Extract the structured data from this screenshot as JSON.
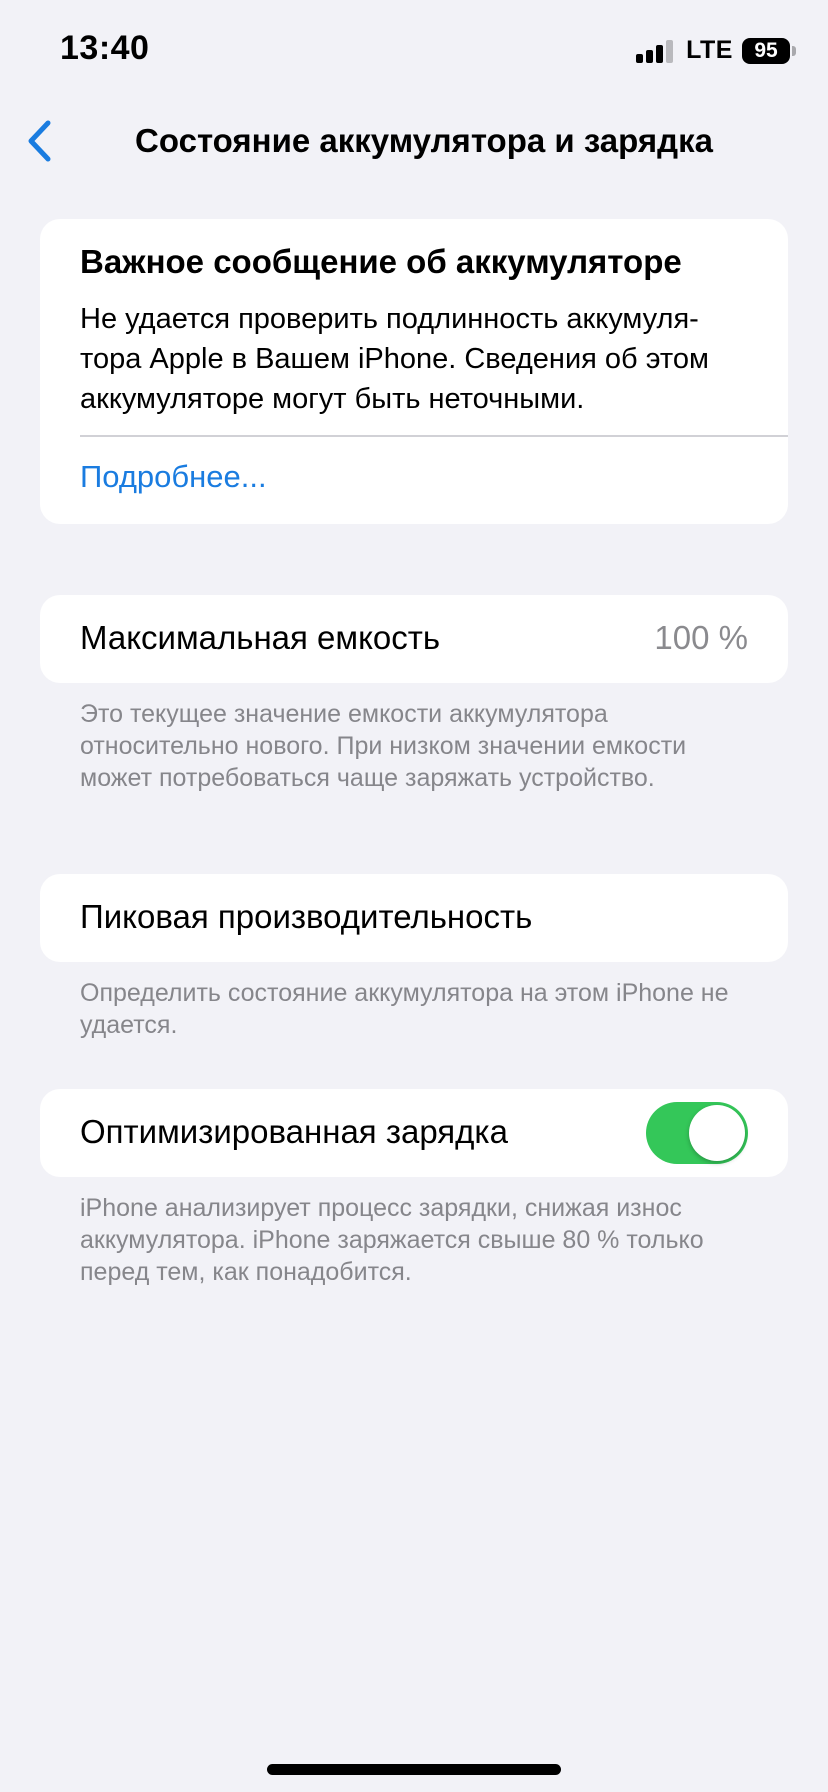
{
  "status_bar": {
    "time": "13:40",
    "network": "LTE",
    "battery_level": "95",
    "signal_bars_active": 3,
    "signal_bars_total": 4
  },
  "nav": {
    "title": "Состояние аккумулятора и зарядка",
    "back_icon": "chevron-left-icon"
  },
  "alert": {
    "title": "Важное сообщение об аккумуляторе",
    "text": "Не удается проверить подлинность аккумуля-тора Apple в Вашем iPhone. Сведения об этом аккумуляторе могут быть неточными.",
    "link": "Подробнее..."
  },
  "capacity": {
    "label": "Максимальная емкость",
    "value": "100 %",
    "footnote": "Это текущее значение емкости аккумулятора относительно нового. При низком значении емкости может потребоваться чаще заряжать устройство."
  },
  "peak": {
    "label": "Пиковая производительность",
    "footnote": "Определить состояние аккумулятора на этом iPhone не удается."
  },
  "optimized": {
    "label": "Оптимизированная зарядка",
    "enabled": true,
    "footnote": "iPhone анализирует процесс зарядки, снижая износ аккумулятора. iPhone заряжается свыше 80 % только перед тем, как понадобится."
  },
  "colors": {
    "accent": "#1a7ce0",
    "toggle_on": "#34c759",
    "background": "#f2f2f7",
    "secondary_text": "#86868b"
  }
}
